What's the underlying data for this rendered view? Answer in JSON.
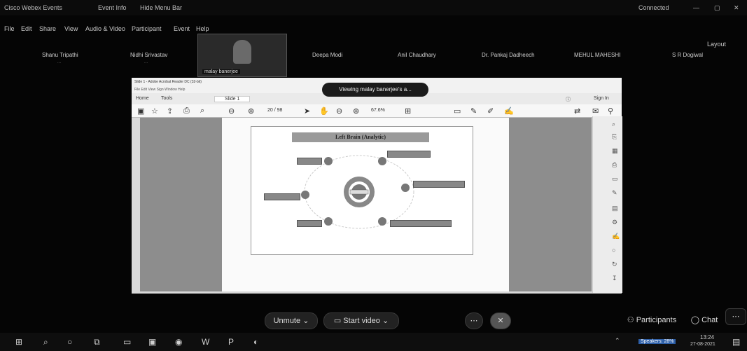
{
  "window": {
    "app_title": "Cisco Webex Events",
    "event_info": "Event Info",
    "hide_menu": "Hide Menu Bar",
    "connected": "Connected",
    "layout": "Layout"
  },
  "menu": [
    "File",
    "Edit",
    "Share",
    "View",
    "Audio & Video",
    "Participant",
    "Event",
    "Help"
  ],
  "participants": [
    {
      "name": "Shanu Tripathi",
      "sub": "..."
    },
    {
      "name": "Nidhi Srivastav",
      "sub": "..."
    },
    {
      "name": "Deepa Modi"
    },
    {
      "name": "Anil Chaudhary"
    },
    {
      "name": "Dr. Pankaj Dadheech"
    },
    {
      "name": "MEHUL MAHESHI"
    },
    {
      "name": "S R Dogiwal"
    }
  ],
  "active_video": {
    "name": "malay banerjee"
  },
  "share": {
    "viewing_banner": "Viewing malay banerjee's a...",
    "acrobat_title": "Slide 1 - Adobe Acrobat Reader DC (32-bit)",
    "acrobat_menu": "File  Edit  View  Sign  Window  Help",
    "tabs": [
      "Home",
      "Tools",
      "Slide 1"
    ],
    "sign_in": "Sign In",
    "page": "20 / 98",
    "zoom": "67.6%",
    "slide_title": "Left Brain (Analytic)"
  },
  "controls": {
    "unmute": "Unmute",
    "start_video": "Start video",
    "participants": "Participants",
    "chat": "Chat"
  },
  "taskbar": {
    "time": "13:24",
    "date": "27-08-2021",
    "speakers": "Speakers: 28%"
  }
}
